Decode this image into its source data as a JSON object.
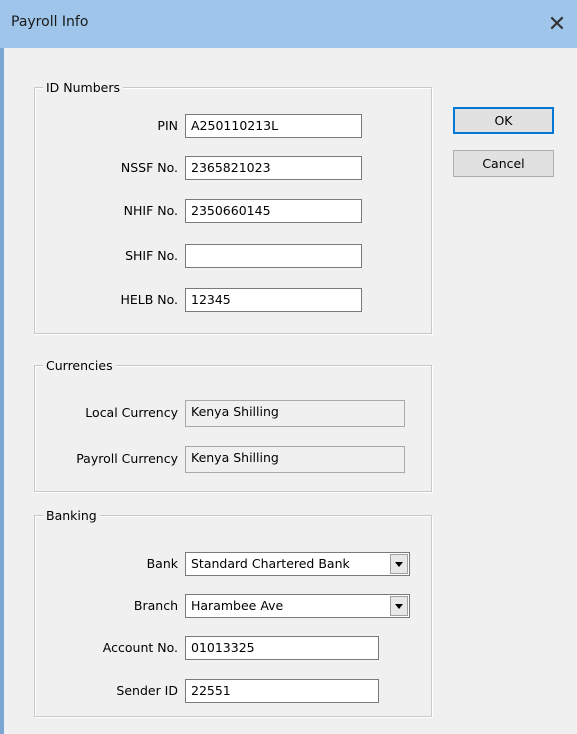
{
  "window": {
    "title": "Payroll Info",
    "close_glyph": "✕"
  },
  "buttons": {
    "ok": "OK",
    "cancel": "Cancel"
  },
  "id_numbers": {
    "legend": "ID Numbers",
    "pin": {
      "label": "PIN",
      "value": "A250110213L"
    },
    "nssf": {
      "label": "NSSF No.",
      "value": "2365821023"
    },
    "nhif": {
      "label": "NHIF No.",
      "value": "2350660145"
    },
    "shif": {
      "label": "SHIF No.",
      "value": ""
    },
    "helb": {
      "label": "HELB No.",
      "value": "12345"
    }
  },
  "currencies": {
    "legend": "Currencies",
    "local": {
      "label": "Local Currency",
      "value": "Kenya Shilling"
    },
    "payroll": {
      "label": "Payroll Currency",
      "value": "Kenya Shilling"
    }
  },
  "banking": {
    "legend": "Banking",
    "bank": {
      "label": "Bank",
      "value": "Standard Chartered Bank"
    },
    "branch": {
      "label": "Branch",
      "value": "Harambee Ave"
    },
    "account": {
      "label": "Account No.",
      "value": "01013325"
    },
    "sender": {
      "label": "Sender ID",
      "value": "22551"
    }
  },
  "colors": {
    "titlebar": "#9fc6ea",
    "dialog_bg": "#f0f0f0",
    "default_button_border": "#0078d7"
  }
}
